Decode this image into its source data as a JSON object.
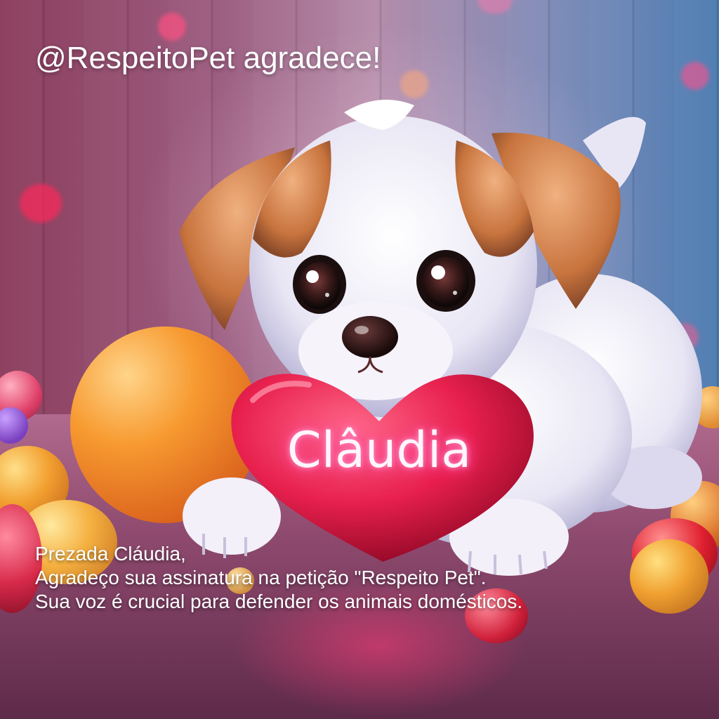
{
  "image": {
    "description": "",
    "title": "@RespeitoPet agradece!",
    "heart_name": "Clâudia",
    "message": {
      "greeting": "Prezada Cláudia,",
      "line1": "Agradeço sua assinatura na petição \"Respeito Pet\".",
      "line2": "Sua voz é crucial para defender os animais domésticos."
    },
    "colors": {
      "heart": "#e8204e",
      "glow": "#ff5fa8",
      "text": "#ffffff"
    }
  }
}
